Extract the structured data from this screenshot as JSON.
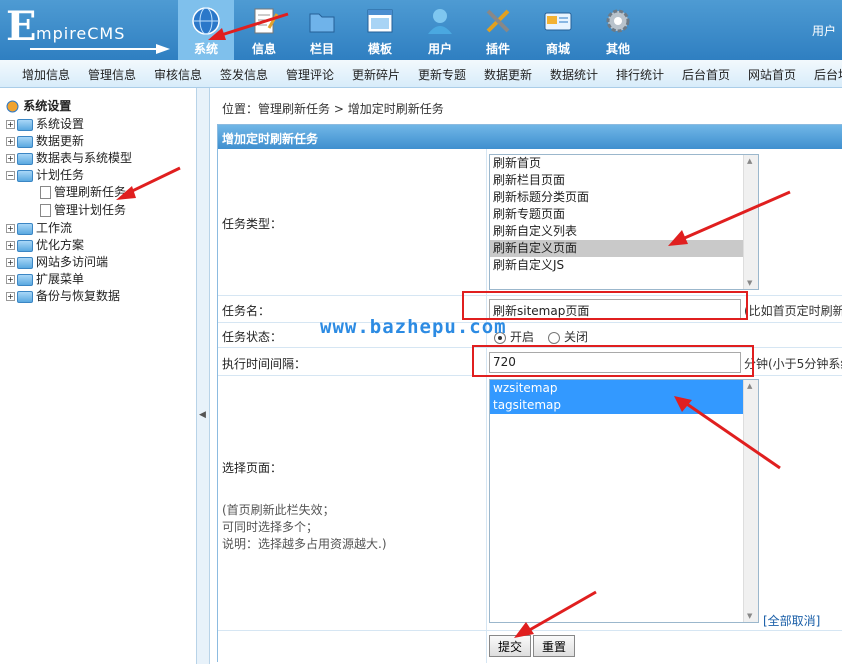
{
  "header": {
    "logo_text": "mpireCMS",
    "logo_initial": "E",
    "nav": [
      {
        "label": "系统",
        "icon": "globe-icon",
        "active": true
      },
      {
        "label": "信息",
        "icon": "document-icon",
        "active": false
      },
      {
        "label": "栏目",
        "icon": "folder-icon",
        "active": false
      },
      {
        "label": "模板",
        "icon": "window-icon",
        "active": false
      },
      {
        "label": "用户",
        "icon": "user-icon",
        "active": false
      },
      {
        "label": "插件",
        "icon": "tools-icon",
        "active": false
      },
      {
        "label": "商城",
        "icon": "card-icon",
        "active": false
      },
      {
        "label": "其他",
        "icon": "gear-icon",
        "active": false
      }
    ],
    "user_link": "用户"
  },
  "toolbar": {
    "items": [
      "增加信息",
      "管理信息",
      "审核信息",
      "签发信息",
      "管理评论",
      "更新碎片",
      "更新专题",
      "数据更新",
      "数据统计",
      "排行统计",
      "后台首页",
      "网站首页",
      "后台地"
    ]
  },
  "sidebar": {
    "root": "系统设置",
    "items": [
      {
        "label": "系统设置",
        "type": "folder",
        "expanded": false
      },
      {
        "label": "数据更新",
        "type": "folder",
        "expanded": false
      },
      {
        "label": "数据表与系统模型",
        "type": "folder",
        "expanded": false
      },
      {
        "label": "计划任务",
        "type": "folder",
        "expanded": true
      },
      {
        "label": "管理刷新任务",
        "type": "doc",
        "expanded": false
      },
      {
        "label": "管理计划任务",
        "type": "doc",
        "expanded": false
      },
      {
        "label": "工作流",
        "type": "folder",
        "expanded": false
      },
      {
        "label": "优化方案",
        "type": "folder",
        "expanded": false
      },
      {
        "label": "网站多访问端",
        "type": "folder",
        "expanded": false
      },
      {
        "label": "扩展菜单",
        "type": "folder",
        "expanded": false
      },
      {
        "label": "备份与恢复数据",
        "type": "folder",
        "expanded": false
      }
    ]
  },
  "breadcrumb": {
    "prefix": "位置：",
    "link": "管理刷新任务",
    "sep": " > ",
    "current": "增加定时刷新任务"
  },
  "form": {
    "title": "增加定时刷新任务",
    "task_type_label": "任务类型：",
    "task_types": [
      {
        "label": "刷新首页",
        "selected": false
      },
      {
        "label": "刷新栏目页面",
        "selected": false
      },
      {
        "label": "刷新标题分类页面",
        "selected": false
      },
      {
        "label": "刷新专题页面",
        "selected": false
      },
      {
        "label": "刷新自定义列表",
        "selected": false
      },
      {
        "label": "刷新自定义页面",
        "selected": true
      },
      {
        "label": "刷新自定义JS",
        "selected": false
      }
    ],
    "task_name_label": "任务名：",
    "task_name_value": "刷新sitemap页面",
    "task_name_hint": "(比如首页定时刷新",
    "status_label": "任务状态：",
    "status_on": "开启",
    "status_off": "关闭",
    "status_value": "开启",
    "interval_label": "执行时间间隔：",
    "interval_value": "720",
    "interval_hint": "分钟(小于5分钟系统",
    "pages_label": "选择页面：",
    "pages_note_1": "(首页刷新此栏失效；",
    "pages_note_2": "可同时选择多个；",
    "pages_note_3": "说明：选择越多占用资源越大.)",
    "pages": [
      {
        "label": "wzsitemap",
        "selected": true
      },
      {
        "label": "tagsitemap",
        "selected": true
      }
    ],
    "cancel_all": "[全部取消]",
    "submit": "提交",
    "reset": "重置"
  },
  "watermark": "www.bazhepu.com",
  "colors": {
    "header": "#3a8ccc",
    "annotation": "#e01f1f",
    "selection": "#3399ff",
    "watermark": "#2c8be3"
  }
}
